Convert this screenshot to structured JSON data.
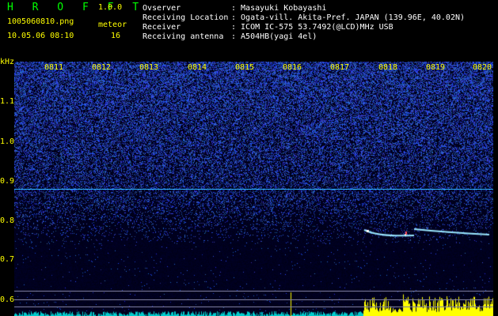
{
  "app": {
    "name": "H R O F F T",
    "version": "1.0.0"
  },
  "file": {
    "name": "1005060810.png",
    "datetime": "10.05.06 08:10"
  },
  "meteor": {
    "label": "meteor",
    "count": "16"
  },
  "info": [
    {
      "key": "Ovserver",
      "value": ": Masayuki Kobayashi"
    },
    {
      "key": "Receiving Location",
      "value": ": Ogata-vill. Akita-Pref. JAPAN (139.96E, 40.02N)"
    },
    {
      "key": "Receiver",
      "value": ": ICOM IC-575 53.7492(@LCD)MHz USB"
    },
    {
      "key": "Receiving antenna",
      "value": ": A504HB(yagi 4el)"
    }
  ],
  "axis": {
    "unit": "kHz",
    "y_ticks": [
      "1.1",
      "1.0",
      "0.9",
      "0.8",
      "0.7",
      "0.6"
    ],
    "x_ticks": [
      "0811",
      "0812",
      "0813",
      "0814",
      "0815",
      "0816",
      "0817",
      "0818",
      "0819",
      "0820"
    ]
  },
  "colors": {
    "label": "#ffff00",
    "title": "#00ff00",
    "noise": "#2a3cff",
    "carrier": "#2fb4ff",
    "echo": "#ffffff"
  }
}
